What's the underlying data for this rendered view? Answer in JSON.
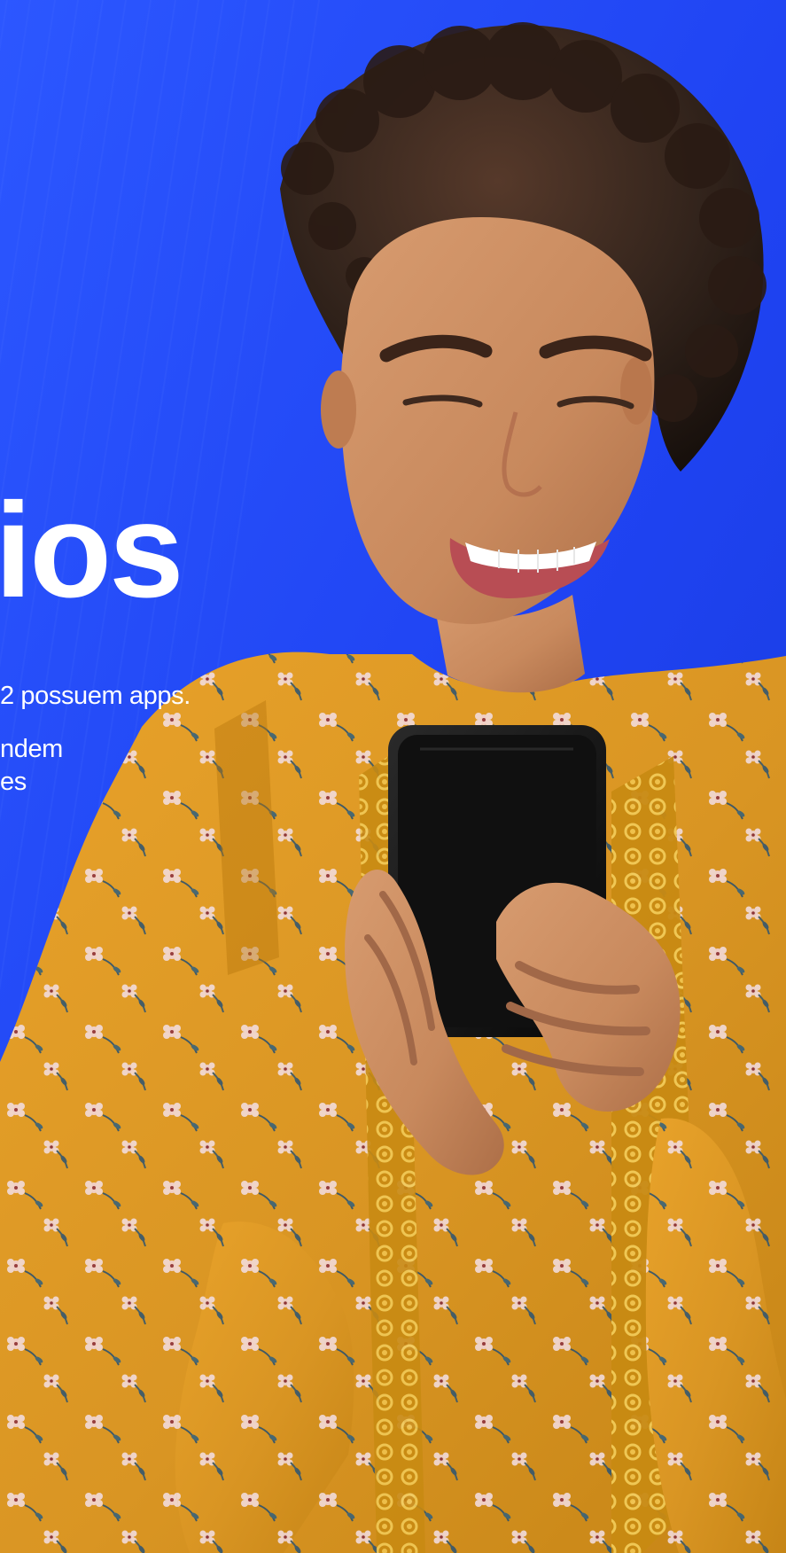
{
  "hero": {
    "title": "ios",
    "copy": {
      "line_1": "2 possuem apps.",
      "line_2": "ndem",
      "line_3": "es"
    },
    "photo_alt": "Smiling woman using a smartphone"
  },
  "colors": {
    "background": "#1f43f2",
    "text": "#ffffff",
    "shirt": "#e5a12b",
    "phone": "#151515",
    "skin": "#c98656",
    "hair": "#2d2019"
  },
  "icons": {
    "phone": "smartphone-icon"
  }
}
